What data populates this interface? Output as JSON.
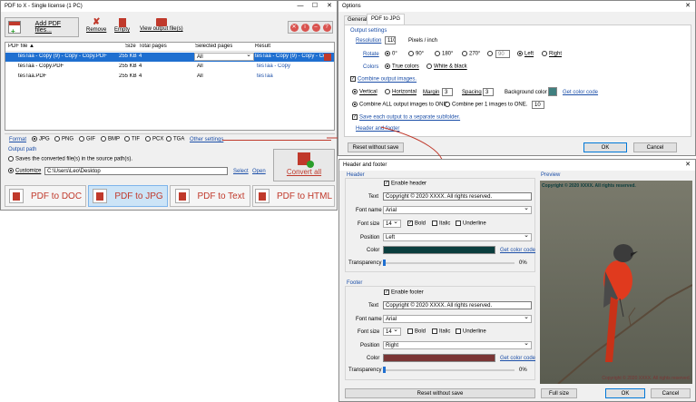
{
  "main": {
    "title": "PDF to X - Single license (1 PC)",
    "toolbar": {
      "add_label": "Add PDF files...",
      "remove_label": "Remove",
      "empty_label": "Empty",
      "view_label": "View output file(s)"
    },
    "columns": [
      "PDF file ▲",
      "Size",
      "Total pages",
      "Selected pages",
      "Result"
    ],
    "rows": [
      {
        "file": "tesTaa - Copy (9) - Copy - Copy.PDF",
        "size": "255 KB",
        "pages": "4",
        "selected": "All",
        "result": "tesTaa - Copy (9) - Copy - Copy.PDF"
      },
      {
        "file": "tesTaa - Copy.PDF",
        "size": "255 KB",
        "pages": "4",
        "selected": "All",
        "result": "tesTaa - Copy"
      },
      {
        "file": "tesTaa.PDF",
        "size": "255 KB",
        "pages": "4",
        "selected": "All",
        "result": "tesTaa"
      }
    ],
    "format_label": "Format",
    "formats": [
      "JPG",
      "PNG",
      "GIF",
      "BMP",
      "TIF",
      "PCX",
      "TGA"
    ],
    "other_settings": "Other settings",
    "output_path_label": "Output path",
    "save_source_label": "Saves the converted file(s) in the source path(s).",
    "customize_label": "Customize",
    "customize_path": "C:\\Users\\Leo\\Desktop",
    "select_label": "Select",
    "open_label": "Open",
    "convert_label": "Convert all",
    "converters": [
      "PDF to DOC",
      "PDF to JPG",
      "PDF to Text",
      "PDF to HTML"
    ]
  },
  "options": {
    "title": "Options",
    "tabs": [
      "General",
      "PDF to JPG"
    ],
    "output_settings_label": "Output settings",
    "resolution_label": "Resolution",
    "resolution_value": "110",
    "resolution_unit": "Pixels / inch",
    "rotate_label": "Rotate",
    "rotations": [
      "0°",
      "90°",
      "180°",
      "270°"
    ],
    "rotate_custom": "90",
    "left_label": "Left",
    "right_label": "Right",
    "colors_label": "Colors",
    "true_colors": "True colors",
    "white_black": "White & black",
    "combine_label": "Combine output images.",
    "vertical_label": "Vertical",
    "horizontal_label": "Horizontal",
    "margin_label": "Margin",
    "margin_value": "3",
    "spacing_label": "Spacing",
    "spacing_value": "3",
    "bg_color_label": "Background color",
    "bg_color": "#3f7f7f",
    "get_color_code": "Get color code",
    "combine_all": "Combine ALL output images to ONE.",
    "combine_per": "Combine per 1 images to ONE.",
    "combine_per_value": "10",
    "subfolder_label": "Save each output to a separate subfolder.",
    "header_footer": "Header and footer",
    "reset_label": "Reset without save",
    "ok_label": "OK",
    "cancel_label": "Cancel"
  },
  "hf": {
    "title": "Header and footer",
    "header_label": "Header",
    "enable_header": "Enable header",
    "text_label": "Text",
    "header_text": "Copyright © 2020 XXXX. All rights reserved.",
    "font_name_label": "Font name",
    "font_name": "Arial",
    "font_size_label": "Font size",
    "font_size": "14",
    "bold": "Bold",
    "italic": "Italic",
    "underline": "Underline",
    "position_label": "Position",
    "header_position": "Left",
    "color_label": "Color",
    "header_color": "#0a3d3d",
    "get_color_code": "Get color code",
    "transparency_label": "Transparency",
    "transparency_value": "0%",
    "footer_label": "Footer",
    "enable_footer": "Enable footer",
    "footer_text": "Copyright © 2020 XXXX. All rights reserved.",
    "footer_position": "Right",
    "footer_color": "#7a3535",
    "preview_label": "Preview",
    "preview_header": "Copyright © 2020 XXXX. All rights reserved.",
    "preview_footer": "Copyright © 2020 XXXX. All rights reserved.",
    "reset_label": "Reset without save",
    "full_size": "Full size",
    "ok_label": "OK",
    "cancel_label": "Cancel"
  }
}
